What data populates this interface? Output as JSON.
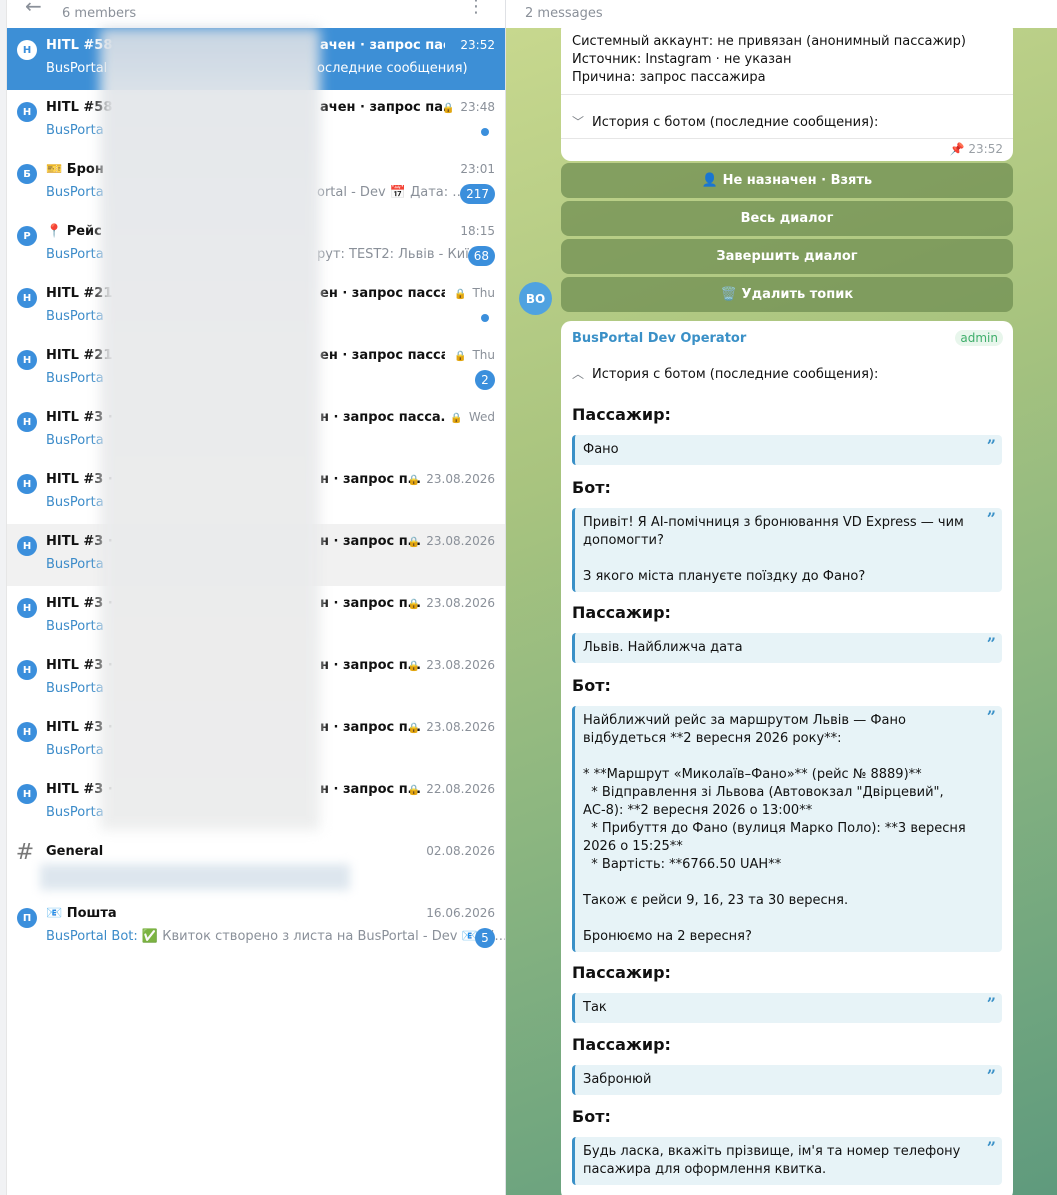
{
  "left": {
    "members": "6 members",
    "rows": [
      {
        "avatar": "H",
        "title": "HITL #58",
        "title2": "ачен · запрос пасса…",
        "sender": "BusPortal",
        "snippet": "оследние сообщения): Пасс…",
        "time": "23:52",
        "lock": false,
        "badge": "",
        "dot": false
      },
      {
        "avatar": "H",
        "title": "HITL #58",
        "title2": "ачен · запрос па…",
        "sender": "BusPorta",
        "snippet": "",
        "time": "23:48",
        "lock": true,
        "badge": "",
        "dot": true
      },
      {
        "avatar": "Б",
        "title": "🎫 Брон",
        "title2": "",
        "sender": "BusPorta",
        "snippet": "ortal - Dev 📅 Дата: …",
        "time": "23:01",
        "lock": false,
        "badge": "217",
        "dot": false
      },
      {
        "avatar": "Р",
        "title": "📍 Рейс",
        "title2": "",
        "sender": "BusPorta",
        "snippet": "рут: TEST2: Львів - Київ…",
        "time": "18:15",
        "lock": false,
        "badge": "68",
        "dot": false
      },
      {
        "avatar": "H",
        "title": "HITL #21",
        "title2": "ен · запрос пасса…",
        "sender": "BusPorta",
        "snippet": "",
        "time": "Thu",
        "lock": true,
        "badge": "",
        "dot": true
      },
      {
        "avatar": "H",
        "title": "HITL #21",
        "title2": "ен · запрос пасса…",
        "sender": "BusPorta",
        "snippet": "",
        "time": "Thu",
        "lock": true,
        "badge": "2",
        "dot": false
      },
      {
        "avatar": "H",
        "title": "HITL #3 ·",
        "title2": "н · запрос пасса…",
        "sender": "BusPorta",
        "snippet": "",
        "time": "Wed",
        "lock": true,
        "badge": "",
        "dot": false
      },
      {
        "avatar": "H",
        "title": "HITL #3 ·",
        "title2": "н · запрос п…",
        "sender": "BusPorta",
        "snippet": "",
        "time": "23.08.2026",
        "lock": true,
        "badge": "",
        "dot": false
      },
      {
        "avatar": "H",
        "title": "HITL #3 ·",
        "title2": "н · запрос п…",
        "sender": "BusPorta",
        "snippet": "",
        "time": "23.08.2026",
        "lock": true,
        "badge": "",
        "dot": false
      },
      {
        "avatar": "H",
        "title": "HITL #3 ·",
        "title2": "н · запрос п…",
        "sender": "BusPorta",
        "snippet": "",
        "time": "23.08.2026",
        "lock": true,
        "badge": "",
        "dot": false
      },
      {
        "avatar": "H",
        "title": "HITL #3 ·",
        "title2": "н · запрос п…",
        "sender": "BusPorta",
        "snippet": "",
        "time": "23.08.2026",
        "lock": true,
        "badge": "",
        "dot": false
      },
      {
        "avatar": "H",
        "title": "HITL #3 ·",
        "title2": "н · запрос п…",
        "sender": "BusPorta",
        "snippet": "",
        "time": "23.08.2026",
        "lock": true,
        "badge": "",
        "dot": false
      },
      {
        "avatar": "H",
        "title": "HITL #3 ·",
        "title2": "н · запрос п…",
        "sender": "BusPorta",
        "snippet": "",
        "time": "22.08.2026",
        "lock": true,
        "badge": "",
        "dot": false
      },
      {
        "avatar": "#",
        "title": "General",
        "title2": "",
        "sender": "",
        "snippet": "",
        "time": "02.08.2026",
        "lock": false,
        "badge": "",
        "dot": false
      },
      {
        "avatar": "П",
        "title": "📧 Пошта",
        "title2": "",
        "sender": "BusPortal Bot:",
        "snippet": "✅ Квиток створено з листа на BusPortal - Dev 📧 Ві…",
        "time": "16.06.2026",
        "lock": false,
        "badge": "5",
        "dot": false
      }
    ]
  },
  "right": {
    "message_count": "2 messages",
    "card1": {
      "lines": [
        "Системный аккаунт: не привязан (анонимный пассажир)",
        "Источник: Instagram · не указан",
        "Причина: запрос пассажира"
      ],
      "history_label": "История с ботом (последние сообщения):",
      "time": "23:52"
    },
    "buttons": [
      "👤 Не назначен · Взять",
      "Весь диалог",
      "Завершить диалог",
      "🗑️ Удалить топик"
    ],
    "card2": {
      "avatar": "BO",
      "sender": "BusPortal Dev Operator",
      "admin": "admin",
      "history_label": "История с ботом (последние сообщения):",
      "messages": [
        {
          "who": "Пассажир:",
          "text": "Фано"
        },
        {
          "who": "Бот:",
          "text": "Привіт! Я АІ-помічниця з бронювання VD Express — чим допомогти?\n\nЗ якого міста плануєте поїздку до Фано?"
        },
        {
          "who": "Пассажир:",
          "text": "Львів. Найближча дата"
        },
        {
          "who": "Бот:",
          "text": "Найближчий рейс за маршрутом Львів — Фано відбудеться **2 вересня 2026 року**:\n\n* **Маршрут «Миколаїв–Фано»** (рейс № 8889)**\n  * Відправлення зі Львова (Автовокзал \"Двірцевий\", АС-8): **2 вересня 2026 о 13:00**\n  * Прибуття до Фано (вулиця Марко Поло): **3 вересня 2026 о 15:25**\n  * Вартість: **6766.50 UAH**\n\nТакож є рейси 9, 16, 23 та 30 вересня.\n\nБронюємо на 2 вересня?"
        },
        {
          "who": "Пассажир:",
          "text": "Так"
        },
        {
          "who": "Пассажир:",
          "text": "Забронюй"
        },
        {
          "who": "Бот:",
          "text": "Будь ласка, вкажіть прізвище, ім'я та номер телефону пасажира для оформлення квитка."
        }
      ]
    }
  }
}
